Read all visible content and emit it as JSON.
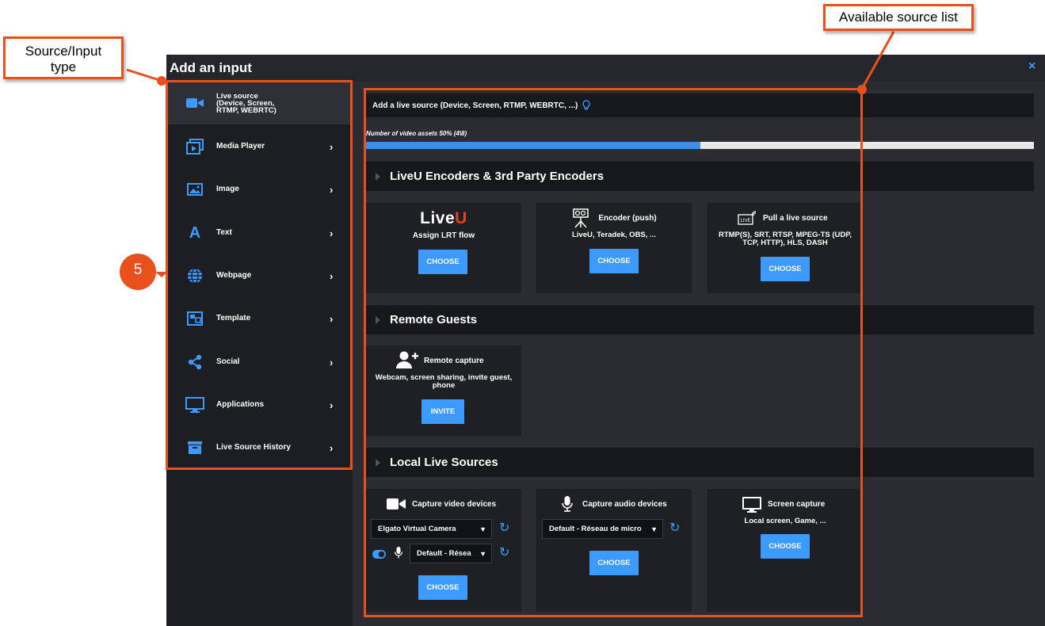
{
  "dialog": {
    "title": "Add an input",
    "close_label": "×"
  },
  "sidebar": {
    "items": [
      {
        "label": "Live source\n(Device, Screen,\nRTMP, WEBRTC)",
        "icon": "video-camera-icon",
        "active": true
      },
      {
        "label": "Media Player",
        "icon": "media-player-icon"
      },
      {
        "label": "Image",
        "icon": "image-icon"
      },
      {
        "label": "Text",
        "icon": "text-icon"
      },
      {
        "label": "Webpage",
        "icon": "globe-icon"
      },
      {
        "label": "Template",
        "icon": "template-icon"
      },
      {
        "label": "Social",
        "icon": "share-icon"
      },
      {
        "label": "Applications",
        "icon": "monitor-icon"
      },
      {
        "label": "Live Source History",
        "icon": "archive-icon"
      }
    ]
  },
  "main": {
    "top_bar": "Add a live source (Device, Screen, RTMP, WEBRTC, ...)",
    "progress": {
      "label": "Number of video assets 50% (4\\8)",
      "value": 0.5
    },
    "sections": {
      "encoders": {
        "title": "LiveU Encoders & 3rd Party Encoders"
      },
      "guests": {
        "title": "Remote Guests"
      },
      "local": {
        "title": "Local Live Sources"
      }
    },
    "cards": {
      "liveu": {
        "logo": "LiveU",
        "title": "Assign LRT flow",
        "button": "CHOOSE"
      },
      "encoder_push": {
        "title": "Encoder (push)",
        "sub": "LiveU, Teradek, OBS, ...",
        "button": "CHOOSE"
      },
      "pull_live": {
        "title": "Pull a live source",
        "sub": "RTMP(S), SRT, RTSP, MPEG-TS (UDP, TCP, HTTP), HLS, DASH",
        "button": "CHOOSE"
      },
      "remote_capture": {
        "title": "Remote capture",
        "sub": "Webcam, screen sharing, invite guest, phone",
        "button": "INVITE"
      },
      "capture_video": {
        "title": "Capture video devices",
        "select_video": "Elgato Virtual Camera",
        "select_audio": "Default - Résea",
        "button": "CHOOSE"
      },
      "capture_audio": {
        "title": "Capture audio devices",
        "select_audio": "Default - Réseau de micro",
        "button": "CHOOSE"
      },
      "screen_capture": {
        "title": "Screen capture",
        "sub": "Local screen, Game, ...",
        "button": "CHOOSE"
      }
    }
  },
  "annotations": {
    "source_type": "Source/Input\ntype",
    "available_list": "Available source list",
    "step_number": "5"
  },
  "colors": {
    "accent": "#3d9bff",
    "annotation": "#e8501c",
    "liveu_red": "#e8401c"
  }
}
